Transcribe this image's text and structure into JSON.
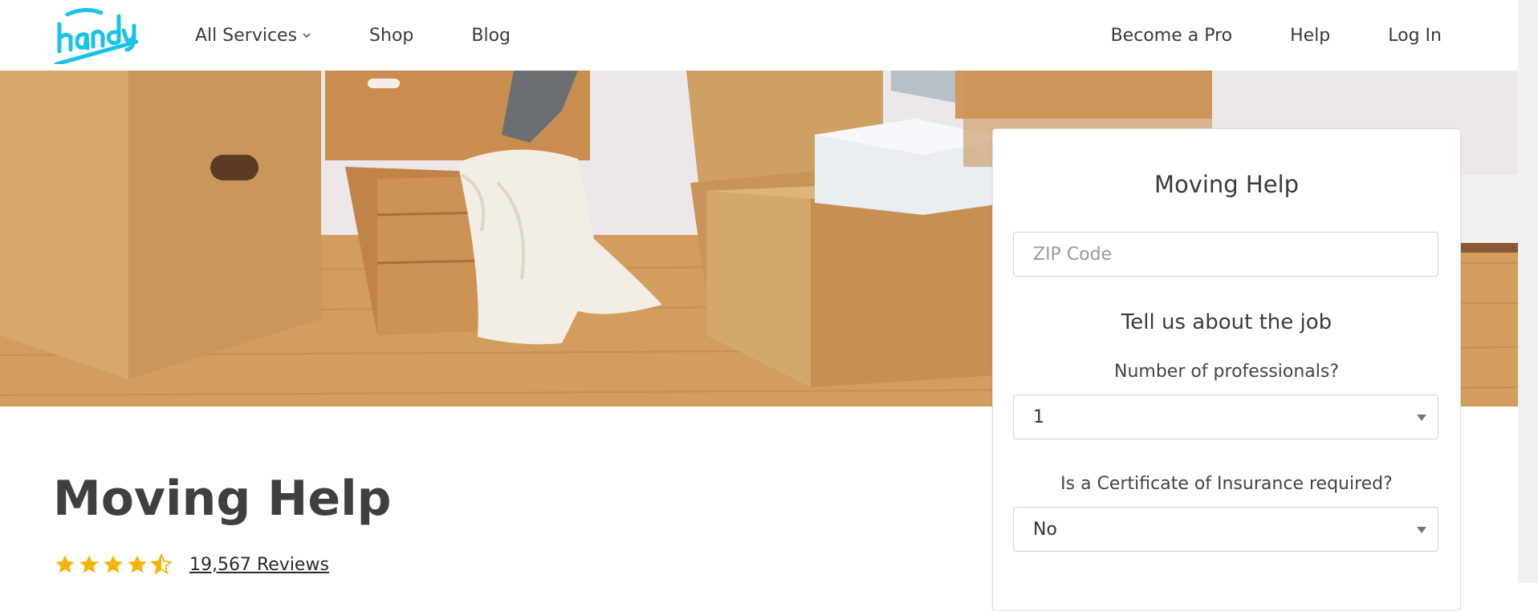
{
  "header": {
    "logo_text": "handy",
    "nav_left": [
      {
        "label": "All Services"
      },
      {
        "label": "Shop"
      },
      {
        "label": "Blog"
      }
    ],
    "nav_right": [
      {
        "label": "Become a Pro"
      },
      {
        "label": "Help"
      },
      {
        "label": "Log In"
      }
    ]
  },
  "form": {
    "title": "Moving Help",
    "zip_placeholder": "ZIP Code",
    "section_title": "Tell us about the job",
    "professionals_label": "Number of professionals?",
    "professionals_value": "1",
    "insurance_label": "Is a Certificate of Insurance required?",
    "insurance_value": "No"
  },
  "page": {
    "title": "Moving Help",
    "rating": 4.5,
    "reviews": "19,567 Reviews"
  },
  "colors": {
    "brand": "#19c3e8",
    "star": "#f5b400"
  }
}
